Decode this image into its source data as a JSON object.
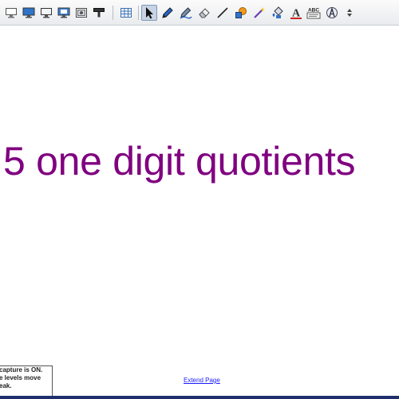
{
  "toolbar": {
    "tools": [
      {
        "name": "screen-capture-icon"
      },
      {
        "name": "monitor-icon"
      },
      {
        "name": "monitor-outline-icon"
      },
      {
        "name": "monitor-capture-icon"
      },
      {
        "name": "photo-capture-icon"
      },
      {
        "name": "video-capture-icon"
      },
      {
        "name": "table-icon"
      },
      {
        "name": "select-arrow-icon",
        "active": true
      },
      {
        "name": "pen-icon"
      },
      {
        "name": "creative-pen-icon"
      },
      {
        "name": "eraser-icon"
      },
      {
        "name": "line-icon"
      },
      {
        "name": "shapes-icon"
      },
      {
        "name": "magic-pen-icon"
      },
      {
        "name": "fill-icon"
      },
      {
        "name": "text-icon"
      },
      {
        "name": "text-abc-icon"
      },
      {
        "name": "measurement-icon"
      },
      {
        "name": "more-icon"
      }
    ],
    "text_tool_glyph": "A",
    "abc_label": "ABC",
    "text_tool_color": "#cc2222"
  },
  "canvas": {
    "title": "5 one digit quotients",
    "title_color": "#800080",
    "extend_link": "Extend Page"
  },
  "notice": {
    "lines": [
      "capture is ON.",
      "e levels move",
      "eak."
    ]
  },
  "colors": {
    "toolbar_bg": "#eef0f2",
    "bottom_bar": "#1e2f6b",
    "link": "#1a1aff"
  }
}
